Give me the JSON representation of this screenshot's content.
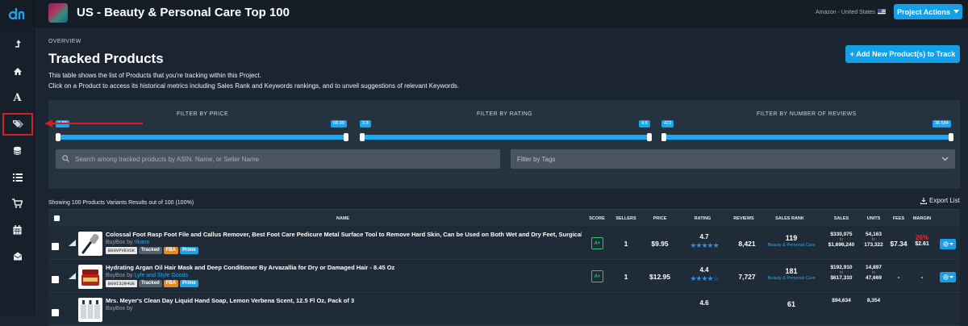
{
  "app": {
    "logo": "dh",
    "logo_color": "#1ea2ea"
  },
  "sidebar": {
    "items": [
      {
        "name": "sidebar-item-import",
        "icon": "upload-arrow-icon"
      },
      {
        "name": "sidebar-item-home",
        "icon": "home-icon"
      },
      {
        "name": "sidebar-item-keywords",
        "icon": "font-a-icon"
      },
      {
        "name": "sidebar-item-tracked-products",
        "icon": "tags-icon",
        "highlighted": true
      },
      {
        "name": "sidebar-item-database",
        "icon": "database-icon"
      },
      {
        "name": "sidebar-item-lists",
        "icon": "list-icon"
      },
      {
        "name": "sidebar-item-cart",
        "icon": "cart-icon"
      },
      {
        "name": "sidebar-item-calendar",
        "icon": "calendar-icon"
      },
      {
        "name": "sidebar-item-mail",
        "icon": "mail-icon"
      }
    ],
    "highlight_color": "#d41f27"
  },
  "header": {
    "project_title": "US - Beauty & Personal Care Top 100",
    "marketplace": "Amazon - United States",
    "project_actions_label": "Project Actions"
  },
  "overview": {
    "eyebrow": "OVERVIEW",
    "title": "Tracked Products",
    "desc_line1": "This table shows the list of Products that you're tracking within this Project.",
    "desc_line2": "Click on a Product to access its historical metrics including Sales Rank and Keywords rankings, and to unveil suggestions of relevant Keywords.",
    "add_button": "+ Add New Product(s) to Track"
  },
  "filters": {
    "price": {
      "label": "FILTER BY PRICE",
      "min": "1.59",
      "max": "68.99"
    },
    "rating": {
      "label": "FILTER BY RATING",
      "min": "3.8",
      "max": "4.8"
    },
    "reviews": {
      "label": "FILTER BY NUMBER OF REVIEWS",
      "min": "423",
      "max": "36 584"
    },
    "search_placeholder": "Search among tracked products by ASIN, Name, or Seller Name",
    "tags_placeholder": "Filter by Tags"
  },
  "table": {
    "showing": "Showing 100 Products Variants Results out of 100 (100%)",
    "export_label": "Export List",
    "columns": [
      "NAME",
      "SCORE",
      "SELLERS",
      "PRICE",
      "RATING",
      "REVIEWS",
      "SALES RANK",
      "SALES",
      "UNITS",
      "FEES",
      "MARGIN"
    ],
    "rows": [
      {
        "title": "Colossal Foot Rasp Foot File and Callus Remover, Best Foot Care Pedicure Metal Surface Tool to Remove Hard Skin, Can be Used on Both Wet and Dry Feet, Surgical Grad...",
        "buybox_prefix": "BuyBox by",
        "seller": "rikans",
        "asin": "B00VPVEVSK",
        "tags": [
          "Tracked",
          "FBA",
          "Prime"
        ],
        "score": "A+",
        "sellers": "1",
        "price": "$9.95",
        "rating": "4.7",
        "stars": "★★★★★",
        "reviews": "8,421",
        "rank": "119",
        "rank_category": "Beauty & Personal Care",
        "sales_low": "$330,075",
        "sales_to": "to",
        "sales_high": "$1,696,240",
        "units_low": "54,163",
        "units_to": "to",
        "units_high": "173,322",
        "fees": "$7.34",
        "margin_pct": "26%",
        "margin_amt": "$2.61"
      },
      {
        "title": "Hydrating Argan Oil Hair Mask and Deep Conditioner By Arvazallia for Dry or Damaged Hair - 8.45 Oz",
        "buybox_prefix": "BuyBox by",
        "seller": "Lyfe and Style Goods",
        "asin": "B00I32R4UE",
        "tags": [
          "Tracked",
          "FBA",
          "Prime"
        ],
        "score": "A+",
        "sellers": "1",
        "price": "$12.95",
        "rating": "4.4",
        "stars": "★★★★☆",
        "reviews": "7,727",
        "rank": "181",
        "rank_category": "Beauty & Personal Care",
        "sales_low": "$192,910",
        "sales_to": "to",
        "sales_high": "$617,310",
        "units_low": "14,897",
        "units_to": "to",
        "units_high": "47,669",
        "fees": "-",
        "margin_pct": "-",
        "margin_amt": ""
      },
      {
        "title": "Mrs. Meyer's Clean Day Liquid Hand Soap, Lemon Verbena Scent, 12.5 Fl Oz, Pack of 3",
        "buybox_prefix": "BuyBox by",
        "seller": "",
        "asin": "",
        "tags": [],
        "score": "",
        "sellers": "",
        "price": "",
        "rating": "4.6",
        "stars": "",
        "reviews": "",
        "rank": "61",
        "rank_category": "",
        "sales_low": "$94,634",
        "sales_to": "",
        "sales_high": "",
        "units_low": "8,354",
        "units_to": "",
        "units_high": "",
        "fees": "",
        "margin_pct": "",
        "margin_amt": ""
      }
    ]
  }
}
